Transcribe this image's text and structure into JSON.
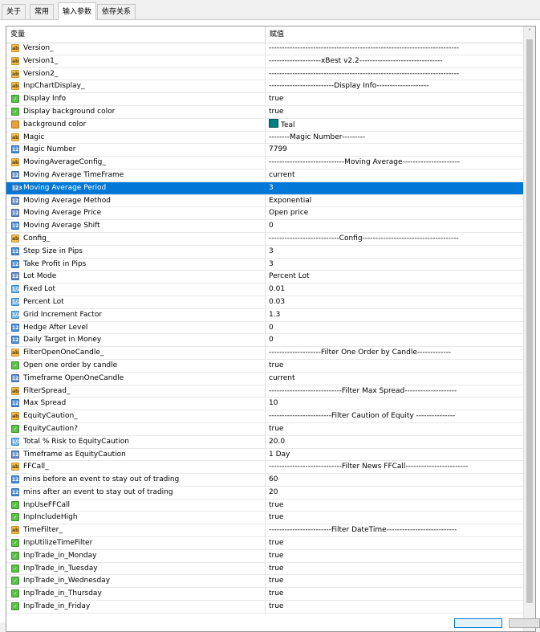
{
  "tabs": [
    {
      "label": "关于"
    },
    {
      "label": "常用"
    },
    {
      "label": "输入参数"
    },
    {
      "label": "依存关系"
    }
  ],
  "table": {
    "col_variable": "变量",
    "col_value": "赋值",
    "rows": [
      {
        "icon": "ab",
        "name": "Version_",
        "value": "-------------------------------------------------------------------------"
      },
      {
        "icon": "ab",
        "name": "Version1_",
        "value": "--------------------xBest v2.2--------------------------------"
      },
      {
        "icon": "ab",
        "name": "Version2_",
        "value": "-------------------------------------------------------------------------"
      },
      {
        "icon": "ab",
        "name": "InpChartDisplay_",
        "value": "-------------------------Display Info--------------------"
      },
      {
        "icon": "bool",
        "name": "Display Info",
        "value": "true"
      },
      {
        "icon": "bool",
        "name": "Display background color",
        "value": "true"
      },
      {
        "icon": "clr",
        "name": "background color",
        "value": "Teal",
        "swatch": "#008080"
      },
      {
        "icon": "ab",
        "name": "Magic",
        "value": "--------Magic Number---------"
      },
      {
        "icon": "num",
        "name": "Magic Number",
        "value": "7799"
      },
      {
        "icon": "ab",
        "name": "MovingAverageConfig_",
        "value": "-----------------------------Moving Average----------------------"
      },
      {
        "icon": "enm",
        "name": "Moving Average TimeFrame",
        "value": "current"
      },
      {
        "icon": "num",
        "name": "Moving Average Period",
        "value": "3",
        "selected": true
      },
      {
        "icon": "enm",
        "name": "Moving Average Method",
        "value": "Exponential"
      },
      {
        "icon": "enm",
        "name": "Moving Average Price",
        "value": "Open price"
      },
      {
        "icon": "num",
        "name": "Moving Average Shift",
        "value": "0"
      },
      {
        "icon": "ab",
        "name": "Config_",
        "value": "---------------------------Config-------------------------------------"
      },
      {
        "icon": "num",
        "name": "Step Size in Pips",
        "value": "3"
      },
      {
        "icon": "num",
        "name": "Take Profit in Pips",
        "value": "3"
      },
      {
        "icon": "enm",
        "name": "Lot Mode",
        "value": "Percent Lot"
      },
      {
        "icon": "dec",
        "name": "Fixed Lot",
        "value": "0.01"
      },
      {
        "icon": "dec",
        "name": "Percent Lot",
        "value": "0.03"
      },
      {
        "icon": "dec",
        "name": "Grid Increment Factor",
        "value": "1.3"
      },
      {
        "icon": "num",
        "name": "Hedge After Level",
        "value": "0"
      },
      {
        "icon": "num",
        "name": "Daily Target in Money",
        "value": "0"
      },
      {
        "icon": "ab",
        "name": "FilterOpenOneCandle_",
        "value": "--------------------Filter One Order by Candle-------------"
      },
      {
        "icon": "bool",
        "name": "Open one order by candle",
        "value": "true"
      },
      {
        "icon": "enm",
        "name": "Timeframe OpenOneCandle",
        "value": "current"
      },
      {
        "icon": "ab",
        "name": "FilterSpread_",
        "value": "----------------------------Filter Max Spread--------------------"
      },
      {
        "icon": "num",
        "name": "Max Spread",
        "value": "10"
      },
      {
        "icon": "ab",
        "name": "EquityCaution_",
        "value": "------------------------Filter Caution of Equity ---------------"
      },
      {
        "icon": "bool",
        "name": "EquityCaution?",
        "value": "true"
      },
      {
        "icon": "dec",
        "name": "Total % Risk to EquityCaution",
        "value": "20.0"
      },
      {
        "icon": "enm",
        "name": "Timeframe as EquityCaution",
        "value": "1 Day"
      },
      {
        "icon": "ab",
        "name": "FFCall_",
        "value": "----------------------------Filter News FFCall------------------------"
      },
      {
        "icon": "num",
        "name": "mins before an event to stay out of trading",
        "value": "60"
      },
      {
        "icon": "num",
        "name": "mins after  an event to stay out of trading",
        "value": "20"
      },
      {
        "icon": "bool",
        "name": "InpUseFFCall",
        "value": "true"
      },
      {
        "icon": "bool",
        "name": "InpIncludeHigh",
        "value": "true"
      },
      {
        "icon": "ab",
        "name": "TimeFilter_",
        "value": "------------------------Filter DateTime---------------------------"
      },
      {
        "icon": "bool",
        "name": "InpUtilizeTimeFilter",
        "value": "true"
      },
      {
        "icon": "bool",
        "name": "InpTrade_in_Monday",
        "value": "true"
      },
      {
        "icon": "bool",
        "name": "InpTrade_in_Tuesday",
        "value": "true"
      },
      {
        "icon": "bool",
        "name": "InpTrade_in_Wednesday",
        "value": "true"
      },
      {
        "icon": "bool",
        "name": "InpTrade_in_Thursday",
        "value": "true"
      },
      {
        "icon": "bool",
        "name": "InpTrade_in_Friday",
        "value": "true"
      }
    ]
  },
  "scrollbar": {
    "up_glyph": "˄",
    "down_glyph": "˅"
  },
  "colors": {
    "selection": "#0078d7",
    "teal": "#008080"
  }
}
